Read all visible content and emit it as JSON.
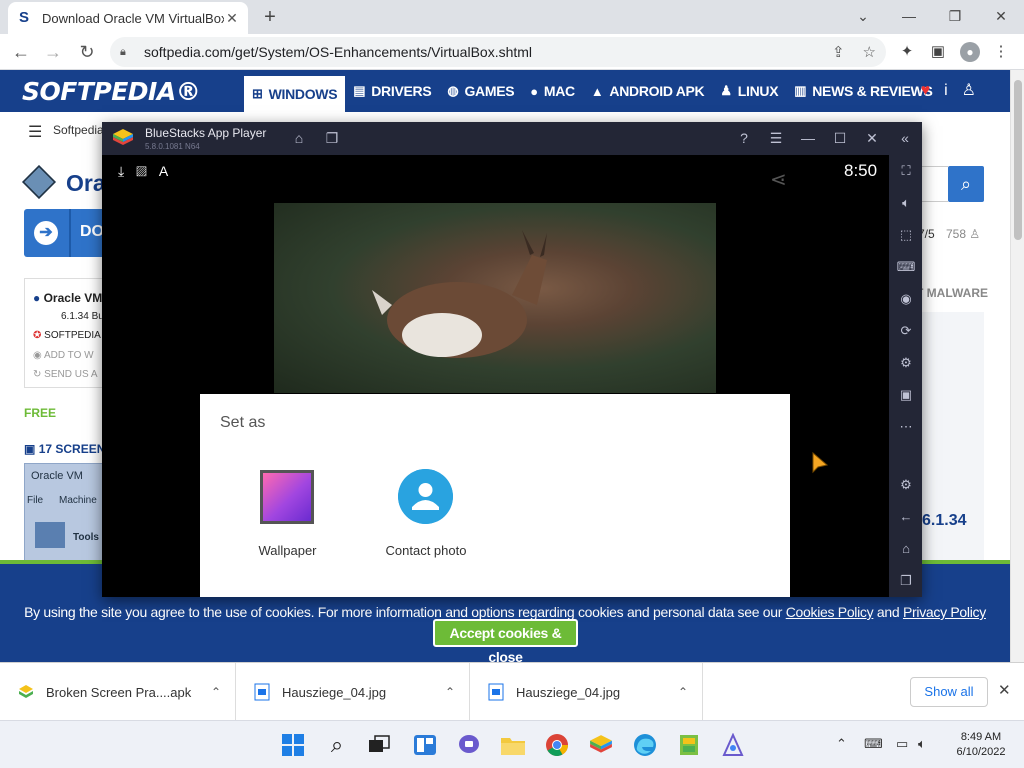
{
  "browser": {
    "tab_title": "Download Oracle VM VirtualBox",
    "tab_favicon": "S",
    "url": "softpedia.com/get/System/OS-Enhancements/VirtualBox.shtml"
  },
  "softpedia": {
    "logo": "SOFTPEDIA®",
    "nav": [
      {
        "label": "WINDOWS",
        "icon": "windows-icon"
      },
      {
        "label": "DRIVERS",
        "icon": "drivers-icon"
      },
      {
        "label": "GAMES",
        "icon": "gamepad-icon"
      },
      {
        "label": "MAC",
        "icon": "apple-icon"
      },
      {
        "label": "ANDROID APK",
        "icon": "android-icon"
      },
      {
        "label": "LINUX",
        "icon": "linux-icon"
      },
      {
        "label": "NEWS & REVIEWS",
        "icon": "news-icon"
      }
    ],
    "breadcrumb": "Softpedia",
    "page_title": "Ora",
    "download_label": "DO",
    "info_title": "Oracle VM",
    "info_version": "6.1.34 Bu",
    "info_softpedia": "SOFTPEDIA",
    "info_add": "ADD TO W",
    "info_send": "SEND US A",
    "free_label": "FREE",
    "screens_label": "17 SCREENS",
    "shot_title": "Oracle VM",
    "shot_menu_file": "File",
    "shot_menu_machine": "Machine",
    "shot_tools": "Tools",
    "rating": "7/5",
    "rating_count": "758",
    "malware": "T MALWARE",
    "version": "6.1.34"
  },
  "cookie": {
    "text": "By using the site you agree to the use of cookies. For more information and options regarding cookies and personal data see our ",
    "policy_link": "Cookies Policy",
    "and": " and ",
    "privacy_link": "Privacy Policy",
    "accept": "Accept cookies & close"
  },
  "bluestacks": {
    "title": "BlueStacks App Player",
    "version": "5.8.0.1081 N64",
    "time": "8:50",
    "dialog_title": "Set as",
    "options": [
      {
        "label": "Wallpaper",
        "icon": "wallpaper-icon"
      },
      {
        "label": "Contact photo",
        "icon": "contact-icon"
      }
    ]
  },
  "downloads": [
    {
      "name": "Broken Screen Pra....apk",
      "icon": "bluestacks-apk-icon"
    },
    {
      "name": "Hausziege_04.jpg",
      "icon": "image-file-icon"
    },
    {
      "name": "Hausziege_04.jpg",
      "icon": "image-file-icon"
    }
  ],
  "downloads_show_all": "Show all",
  "taskbar": {
    "time": "8:49 AM",
    "date": "6/10/2022"
  },
  "colors": {
    "softpedia_blue": "#17408b",
    "softpedia_green": "#6dbb37",
    "bluestacks_bg": "#232636",
    "contact_blue": "#29a3e0"
  }
}
